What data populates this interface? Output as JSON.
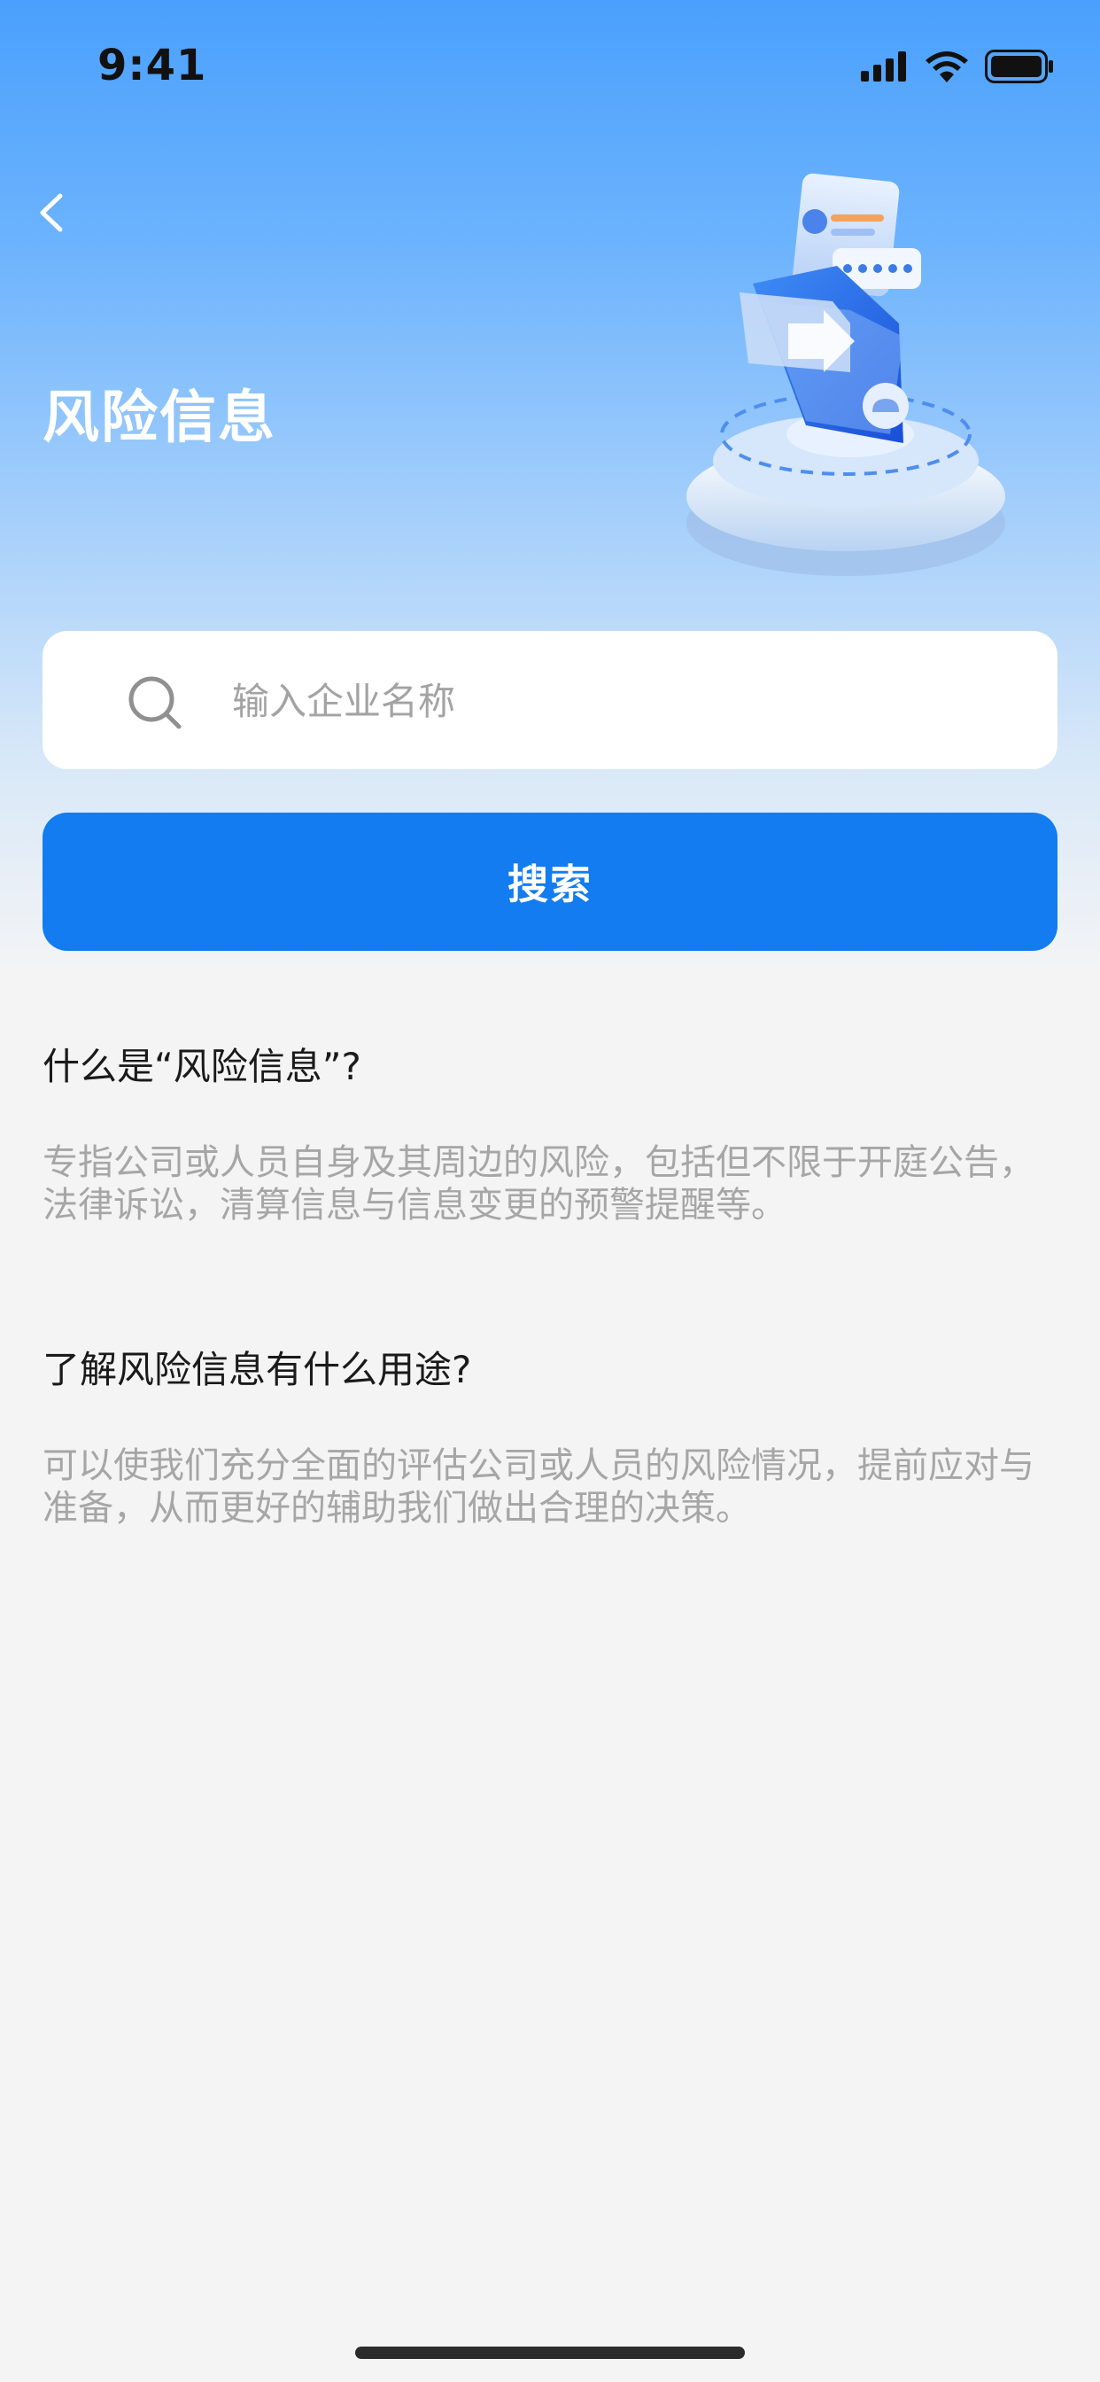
{
  "status_bar": {
    "time": "9:41"
  },
  "header": {
    "title": "风险信息"
  },
  "search": {
    "placeholder": "输入企业名称",
    "button_label": "搜索"
  },
  "sections": [
    {
      "title": "什么是“风险信息”?",
      "body": "专指公司或人员自身及其周边的风险，包括但不限于开庭公告，法律诉讼，清算信息与信息变更的预警提醒等。"
    },
    {
      "title": "了解风险信息有什么用途?",
      "body": "可以使我们充分全面的评估公司或人员的风险情况，提前应对与准备，从而更好的辅助我们做出合理的决策。"
    }
  ],
  "colors": {
    "primary": "#127cf0",
    "header_gradient_top": "#4aa0fd",
    "background": "#f4f4f5"
  }
}
